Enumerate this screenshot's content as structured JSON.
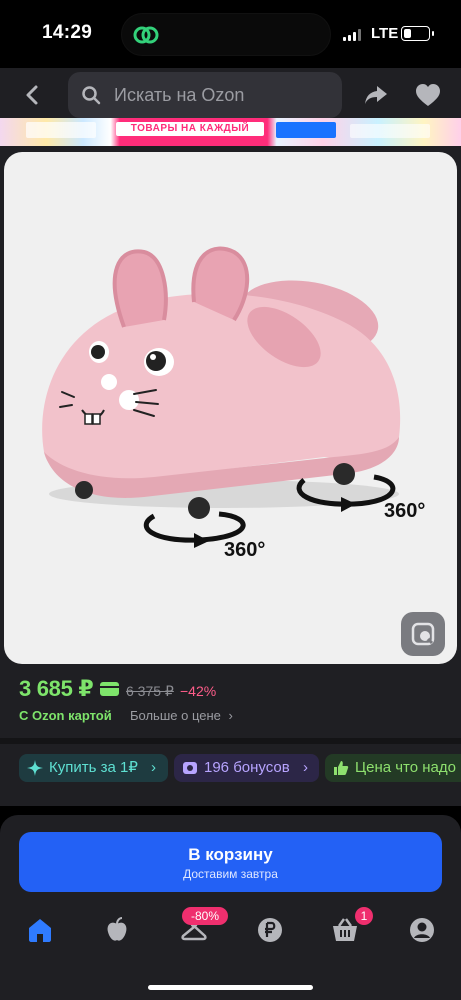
{
  "status_bar": {
    "time": "14:29",
    "network": "LTE",
    "battery_level": 0.3
  },
  "top_nav": {
    "search_placeholder": "Искать на Ozon"
  },
  "banner": {
    "promo_text": "ТОВАРЫ НА КАЖДЫЙ"
  },
  "product": {
    "annotations": [
      "360°",
      "360°"
    ]
  },
  "price": {
    "current": "3 685 ₽",
    "old": "6 375 ₽",
    "discount": "−42%",
    "ozon_card_label": "С Ozon картой",
    "more_price_label": "Больше о цене",
    "more_price_chevron": "›"
  },
  "chips": [
    {
      "label": "Купить за 1₽",
      "icon": "sparkle-icon",
      "chevron": "›"
    },
    {
      "label": "196 бонусов",
      "icon": "bonus-icon",
      "chevron": "›"
    },
    {
      "label": "Цена что надо",
      "icon": "thumbs-up-icon",
      "chevron": ""
    }
  ],
  "cta": {
    "title": "В корзину",
    "subtitle": "Доставим завтра"
  },
  "tab_bar": {
    "items": [
      {
        "name": "home-icon",
        "active": true
      },
      {
        "name": "fresh-icon",
        "active": false
      },
      {
        "name": "hanger-icon",
        "badge": "-80%"
      },
      {
        "name": "ruble-icon",
        "active": false
      },
      {
        "name": "cart-icon",
        "badge": "1"
      },
      {
        "name": "profile-icon",
        "active": false
      }
    ]
  },
  "colors": {
    "price_green": "#7ee46b",
    "discount_pink": "#ff5d8a",
    "cta_blue": "#2361f5",
    "badge_pink": "#ef2f6e",
    "active_tab": "#2f7bff"
  }
}
